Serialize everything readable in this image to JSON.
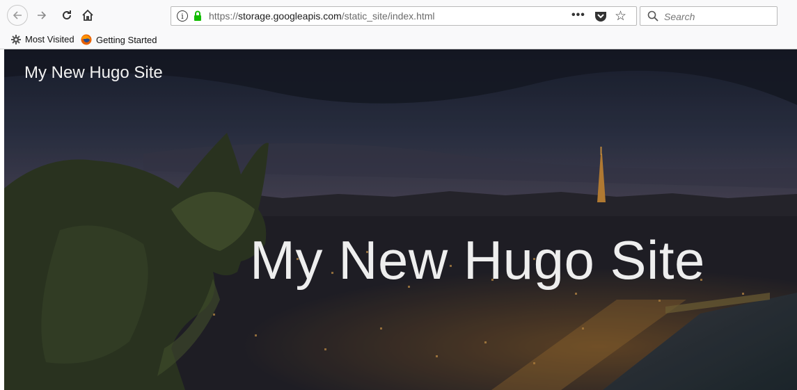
{
  "browser": {
    "toolbar": {
      "back_icon": "back-arrow-icon",
      "forward_icon": "forward-arrow-icon",
      "reload_icon": "reload-icon",
      "home_icon": "home-icon"
    },
    "urlbar": {
      "url_prefix": "https://",
      "url_domain": "storage.googleapis.com",
      "url_path": "/static_site/index.html",
      "more_label": "•••"
    },
    "search": {
      "placeholder": "Search"
    },
    "bookmarks": [
      {
        "label": "Most Visited",
        "icon": "gear-icon"
      },
      {
        "label": "Getting Started",
        "icon": "firefox-icon"
      }
    ]
  },
  "page": {
    "site_title": "My New Hugo Site",
    "hero_title": "My New Hugo Site"
  },
  "colors": {
    "lock_green": "#12bc00",
    "sky_dark": "#1d2230",
    "city_lights": "#e0a546"
  }
}
